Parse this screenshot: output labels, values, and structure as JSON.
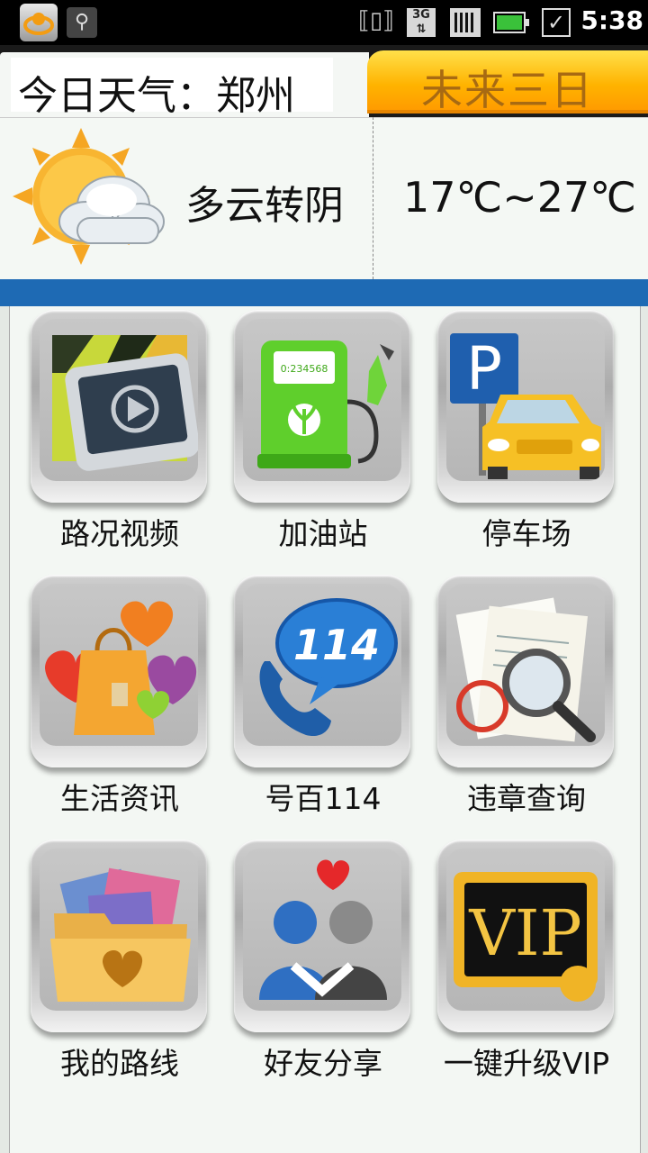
{
  "status_bar": {
    "time": "5:38",
    "network": "3G",
    "icons": [
      "app-icon",
      "usb-icon",
      "vibrate-icon",
      "3g-icon",
      "signal-icon",
      "battery-icon",
      "checkbox-icon"
    ]
  },
  "header": {
    "title": "今日天气：郑州",
    "future_button": "未来三日"
  },
  "weather": {
    "condition": "多云转阴",
    "temperature": "17℃~27℃",
    "icon": "partly-cloudy-icon"
  },
  "menu": [
    {
      "label": "路况视频",
      "icon": "traffic-video-icon"
    },
    {
      "label": "加油站",
      "icon": "gas-station-icon"
    },
    {
      "label": "停车场",
      "icon": "parking-icon"
    },
    {
      "label": "生活资讯",
      "icon": "life-info-icon"
    },
    {
      "label": "号百114",
      "icon": "phone-114-icon"
    },
    {
      "label": "违章查询",
      "icon": "violation-search-icon"
    },
    {
      "label": "我的路线",
      "icon": "my-route-icon"
    },
    {
      "label": "好友分享",
      "icon": "friend-share-icon"
    },
    {
      "label": "一键升级VIP",
      "icon": "vip-icon"
    }
  ],
  "colors": {
    "accent_blue": "#1e6ab4",
    "orange_button": "#ffb300",
    "background": "#f3f7f3"
  }
}
